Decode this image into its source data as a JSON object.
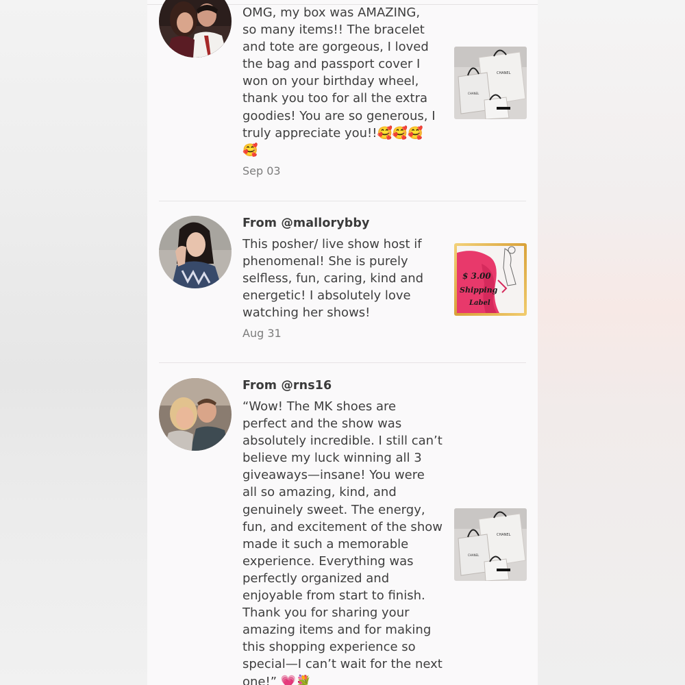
{
  "reviews": [
    {
      "from": "",
      "text": "OMG, my box was AMAZING,\nso many items!! The bracelet\nand tote are gorgeous, I loved\nthe bag and passport cover I\nwon on your birthday wheel,\nthank you too for all the extra\ngoodies! You are so generous, I\ntruly appreciate you!!🥰🥰🥰\n🥰",
      "date": "Sep 03",
      "thumbnail": "chanel-shopping-bags"
    },
    {
      "from": "From @mallorybby",
      "text": "This posher/ live show host if\nphenomenal! She is purely\nselfless, fun, caring, kind and\nenergetic! I absolutely love\nwatching her shows!",
      "date": "Aug 31",
      "thumbnail": "shipping-label-graphic",
      "thumbnail_text": [
        "$ 3.00",
        "Shipping",
        "Label"
      ]
    },
    {
      "from": "From @rns16",
      "text": "“Wow! The MK shoes are\nperfect and the show was\nabsolutely incredible. I still can’t\nbelieve my luck winning all 3\ngiveaways—insane! You were\nall so amazing, kind, and\ngenuinely sweet. The energy,\nfun, and excitement of the show\nmade it such a memorable\nexperience. Everything was\nperfectly organized and\nenjoyable from start to finish.\nThank you for sharing your\namazing items and for making\nthis shopping experience so\nspecial—I can’t wait for the next\none!” 💗💐",
      "date": "",
      "thumbnail": "chanel-shopping-bags"
    }
  ],
  "colors": {
    "panel": "#faf9fa",
    "text": "#3e3e3e",
    "date": "#7c7c7c",
    "divider": "#e6e3e5",
    "label_pink": "#e8396b",
    "label_gold": "#e7b94c"
  }
}
